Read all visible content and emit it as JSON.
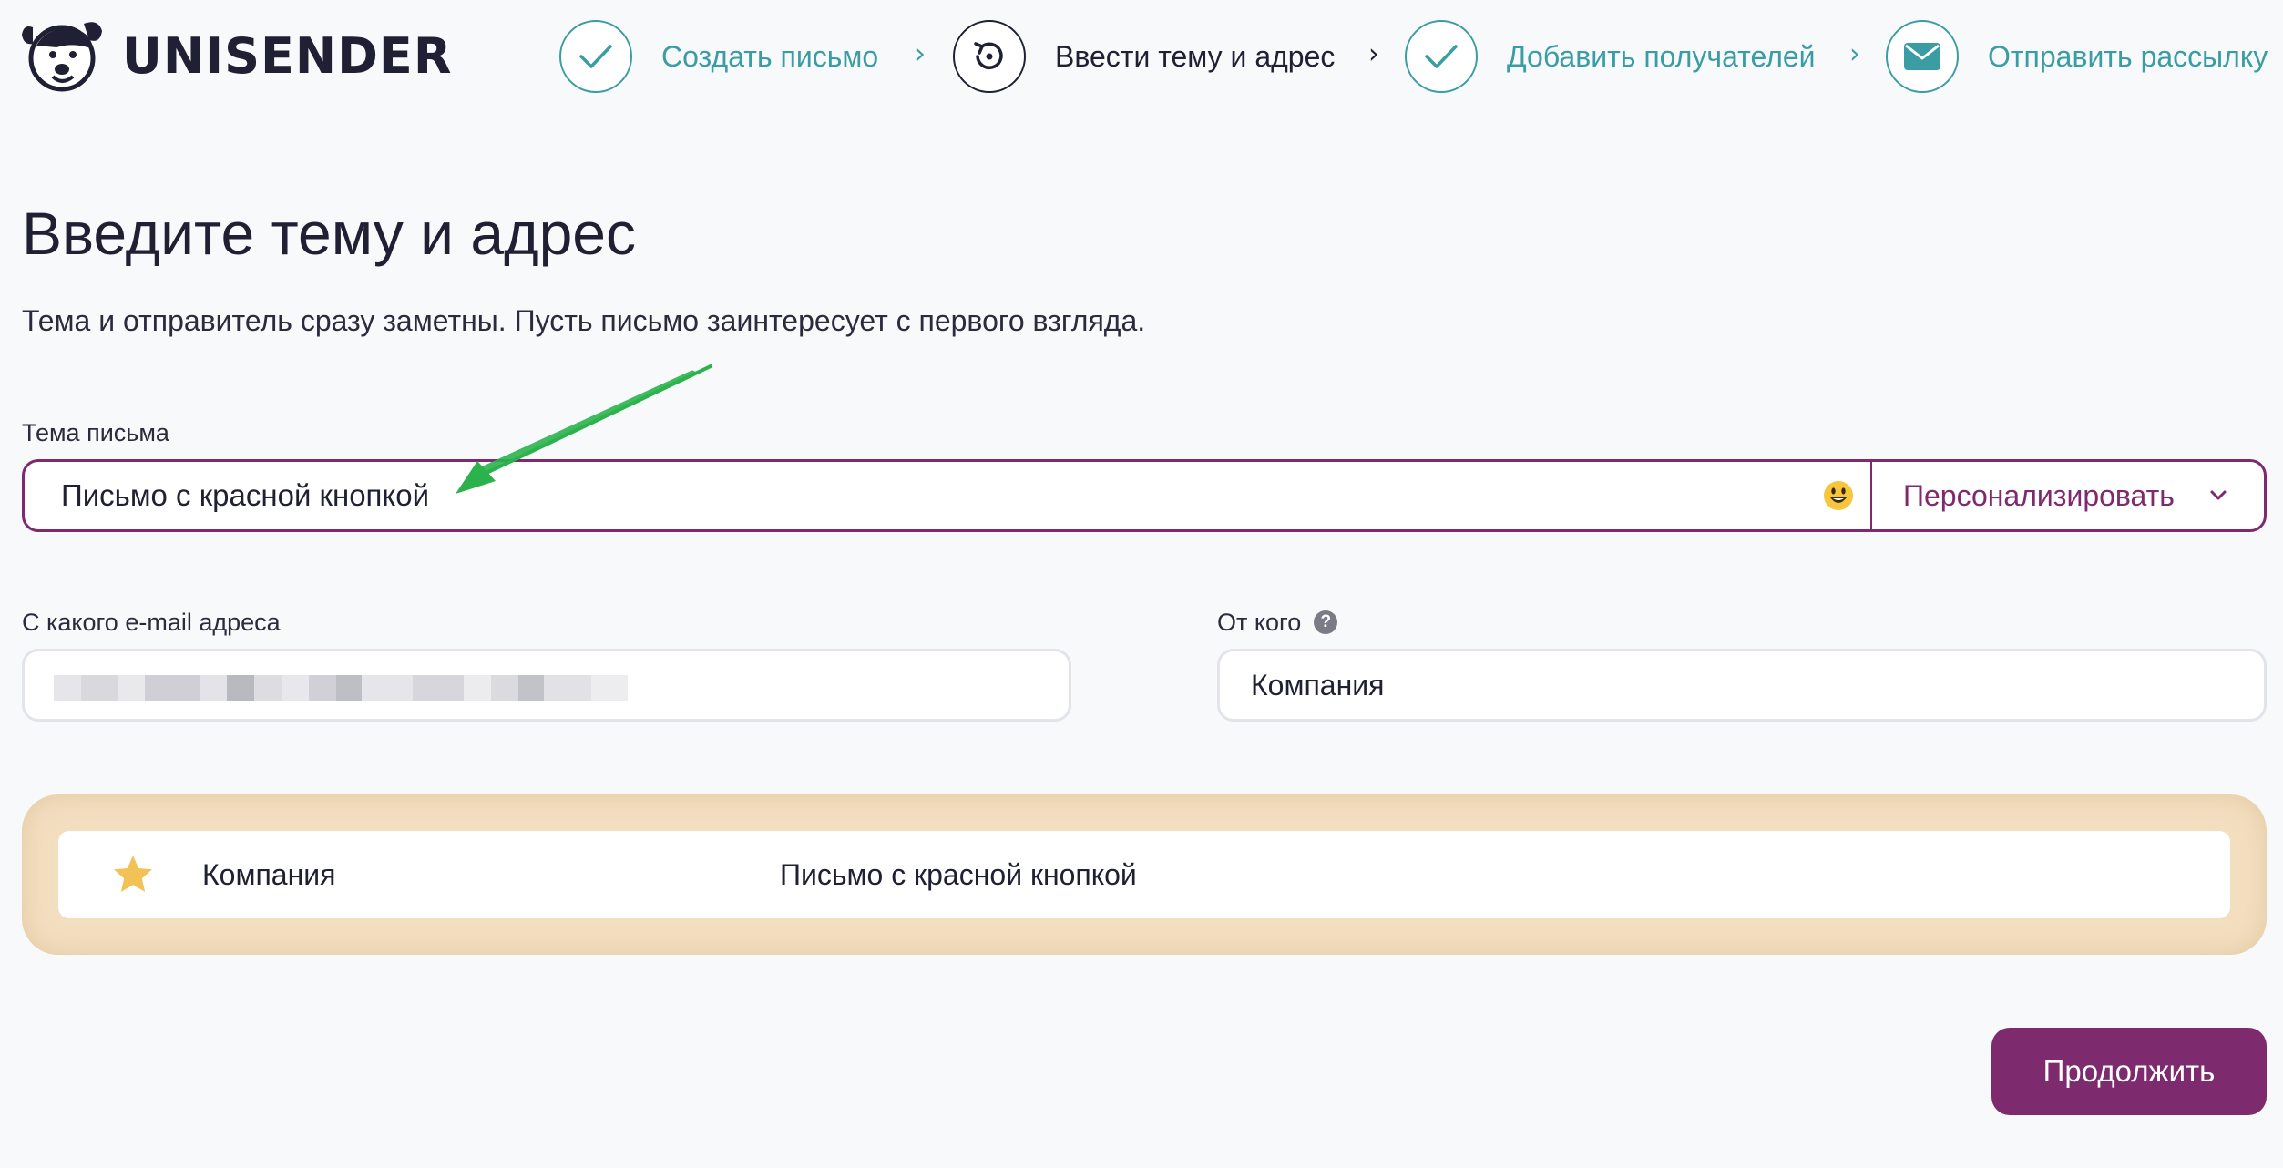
{
  "header": {
    "brand": "UNISENDER",
    "steps": [
      {
        "label": "Создать письмо",
        "state": "done",
        "icon": "check-icon"
      },
      {
        "label": "Ввести тему и адрес",
        "state": "current",
        "icon": "progress-icon"
      },
      {
        "label": "Добавить получателей",
        "state": "done",
        "icon": "check-icon"
      },
      {
        "label": "Отправить рассылку",
        "state": "pending",
        "icon": "envelope-icon"
      }
    ],
    "separator": "›"
  },
  "main": {
    "title": "Введите тему и адрес",
    "subtitle": "Тема и отправитель сразу заметны. Пусть письмо заинтересует с первого взгляда.",
    "subject": {
      "label": "Тема письма",
      "value": "Письмо с красной кнопкой",
      "personalize_label": "Персонализировать"
    },
    "sender_email": {
      "label": "С какого e-mail адреса",
      "value": ""
    },
    "sender_name": {
      "label": "От кого",
      "help": "?",
      "value": "Компания"
    },
    "preview": {
      "sender": "Компания",
      "subject": "Письмо с красной кнопкой"
    },
    "continue_label": "Продолжить"
  },
  "colors": {
    "accent": "#7d2a6f",
    "teal": "#3a9da4",
    "preview_bg": "#f3dfc0",
    "annotation_arrow": "#2bb24c"
  }
}
